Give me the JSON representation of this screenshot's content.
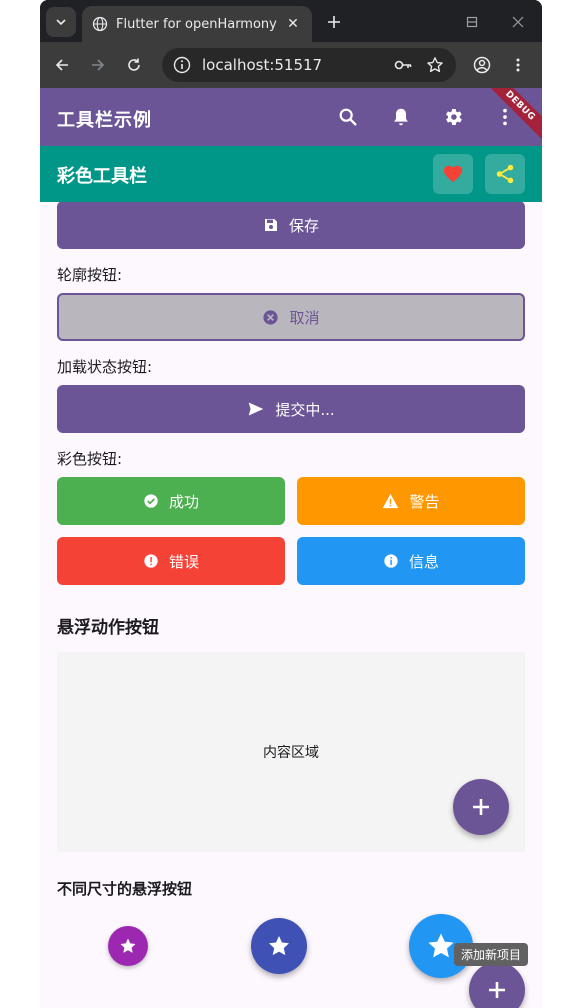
{
  "browser": {
    "tab_title": "Flutter for openHarmony",
    "url": "localhost:51517"
  },
  "app": {
    "title": "工具栏示例",
    "debug_banner": "DEBUG",
    "color_toolbar_title": "彩色工具栏",
    "colors": {
      "primary": "#6b5596",
      "teal": "#009688",
      "success": "#4caf50",
      "warning": "#ff9800",
      "error": "#f44336",
      "info": "#2196f3",
      "background": "#fdf7fe"
    }
  },
  "buttons": {
    "save": "保存",
    "outline_label": "轮廓按钮:",
    "cancel": "取消",
    "loading_label": "加载状态按钮:",
    "submitting": "提交中...",
    "color_label": "彩色按钮:",
    "success": "成功",
    "warning": "警告",
    "error": "错误",
    "info": "信息"
  },
  "fab_section": {
    "title": "悬浮动作按钮",
    "content_area": "内容区域",
    "sizes_title": "不同尺寸的悬浮按钮",
    "tooltip": "添加新项目"
  },
  "icons": [
    "search-icon",
    "bell-icon",
    "gear-icon",
    "more-vert-icon",
    "heart-icon",
    "share-icon",
    "save-icon",
    "cancel-icon",
    "send-icon",
    "check-circle-icon",
    "warning-icon",
    "error-icon",
    "info-icon",
    "add-icon",
    "star-icon"
  ]
}
